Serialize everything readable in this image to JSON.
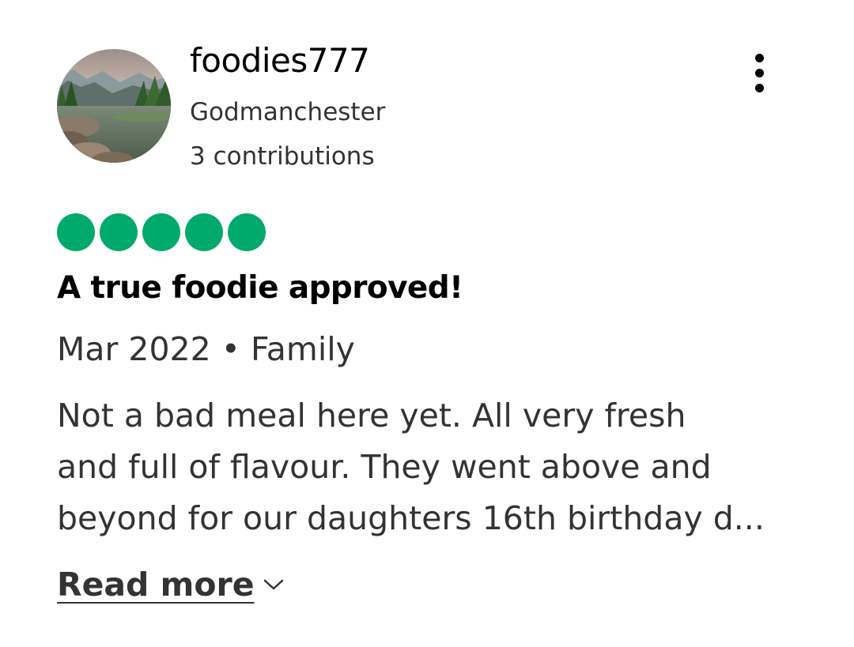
{
  "reviewer": {
    "username": "foodies777",
    "location": "Godmanchester",
    "contributions": "3 contributions",
    "avatar_icon": "landscape-avatar-icon"
  },
  "menu": {
    "icon": "more-vertical-icon"
  },
  "review": {
    "rating": 5,
    "rating_max": 5,
    "rating_color": "#00aa6c",
    "title": "A true foodie approved!",
    "meta": "Mar 2022 • Family",
    "text_lines": [
      "Not a bad meal here yet. All very fresh",
      "and full of flavour. They went above and",
      "beyond for our daughters 16th birthday d..."
    ],
    "read_more": "Read more",
    "read_more_icon": "chevron-down-icon"
  }
}
